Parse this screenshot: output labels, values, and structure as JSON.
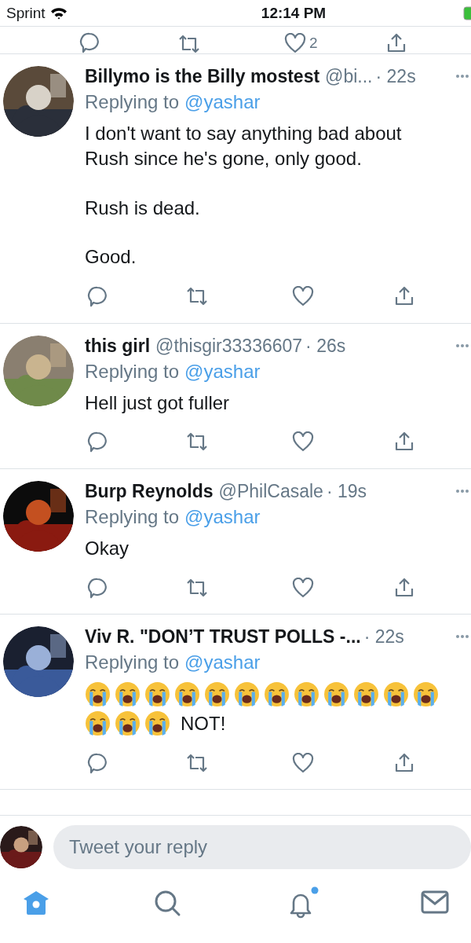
{
  "status_bar": {
    "carrier": "Sprint",
    "time": "12:14 PM"
  },
  "previous_tweet_actions": {
    "like_count": "2"
  },
  "tweets": [
    {
      "name": "Billymo is the Billy mostest",
      "handle": "@bi...",
      "time": "· 22s",
      "replying_label": "Replying to",
      "reply_to": "@yashar",
      "avatar": {
        "kind": "picture"
      },
      "paragraphs": [
        "I don't want to say anything bad about Rush since he's gone, only good.",
        "Rush is dead.",
        "Good."
      ]
    },
    {
      "name": "this girl",
      "handle": "@thisgir33336607",
      "time": "· 26s",
      "replying_label": "Replying to",
      "reply_to": "@yashar",
      "avatar": {
        "kind": "picture"
      },
      "paragraphs": [
        "Hell just got fuller"
      ]
    },
    {
      "name": "Burp Reynolds",
      "handle": "@PhilCasale",
      "time": "· 19s",
      "replying_label": "Replying to",
      "reply_to": "@yashar",
      "avatar": {
        "kind": "picture"
      },
      "paragraphs": [
        "Okay"
      ]
    },
    {
      "name": "Viv R. \"DON’T TRUST POLLS -...",
      "time": "· 22s",
      "replying_label": "Replying to",
      "reply_to": "@yashar",
      "avatar": {
        "kind": "picture"
      },
      "emoji": [
        {
          "kind": "crying-face"
        },
        {
          "kind": "crying-face"
        },
        {
          "kind": "crying-face"
        },
        {
          "kind": "crying-face"
        },
        {
          "kind": "crying-face"
        },
        {
          "kind": "crying-face"
        },
        {
          "kind": "crying-face"
        },
        {
          "kind": "crying-face"
        },
        {
          "kind": "crying-face"
        },
        {
          "kind": "crying-face"
        },
        {
          "kind": "crying-face"
        },
        {
          "kind": "crying-face"
        },
        {
          "kind": "crying-face"
        },
        {
          "kind": "crying-face"
        },
        {
          "kind": "crying-face"
        }
      ],
      "emoji_suffix": "NOT!"
    }
  ],
  "reply_bar": {
    "placeholder": "Tweet your reply",
    "avatar": {
      "kind": "picture"
    }
  },
  "tabs": [
    {
      "kind": "home",
      "selected": true,
      "unread": false
    },
    {
      "kind": "search",
      "selected": false,
      "unread": false
    },
    {
      "kind": "notifications",
      "selected": false,
      "unread": true
    },
    {
      "kind": "messages",
      "selected": false,
      "unread": false
    }
  ]
}
